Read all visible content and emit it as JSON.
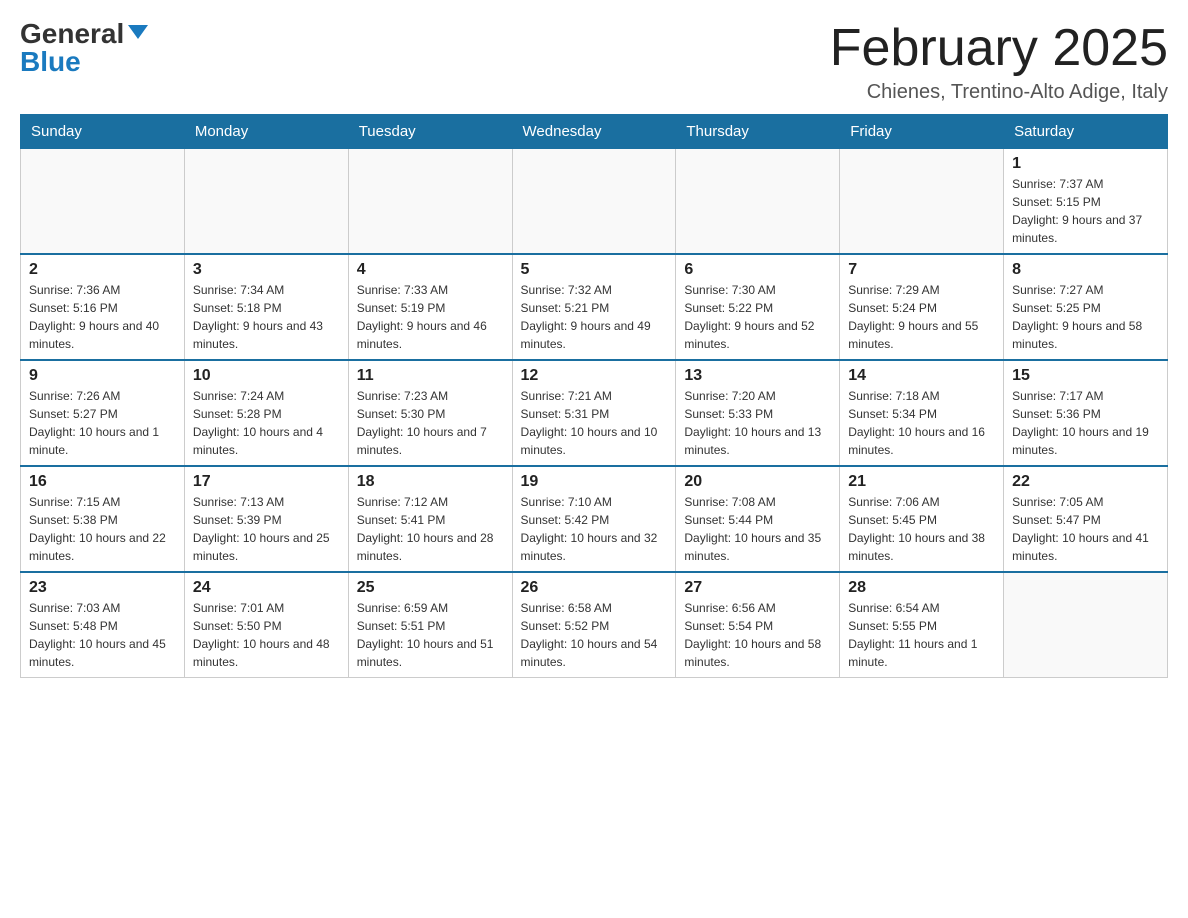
{
  "logo": {
    "general": "General",
    "blue": "Blue"
  },
  "title": "February 2025",
  "location": "Chienes, Trentino-Alto Adige, Italy",
  "weekdays": [
    "Sunday",
    "Monday",
    "Tuesday",
    "Wednesday",
    "Thursday",
    "Friday",
    "Saturday"
  ],
  "weeks": [
    [
      {
        "day": "",
        "info": ""
      },
      {
        "day": "",
        "info": ""
      },
      {
        "day": "",
        "info": ""
      },
      {
        "day": "",
        "info": ""
      },
      {
        "day": "",
        "info": ""
      },
      {
        "day": "",
        "info": ""
      },
      {
        "day": "1",
        "info": "Sunrise: 7:37 AM\nSunset: 5:15 PM\nDaylight: 9 hours and 37 minutes."
      }
    ],
    [
      {
        "day": "2",
        "info": "Sunrise: 7:36 AM\nSunset: 5:16 PM\nDaylight: 9 hours and 40 minutes."
      },
      {
        "day": "3",
        "info": "Sunrise: 7:34 AM\nSunset: 5:18 PM\nDaylight: 9 hours and 43 minutes."
      },
      {
        "day": "4",
        "info": "Sunrise: 7:33 AM\nSunset: 5:19 PM\nDaylight: 9 hours and 46 minutes."
      },
      {
        "day": "5",
        "info": "Sunrise: 7:32 AM\nSunset: 5:21 PM\nDaylight: 9 hours and 49 minutes."
      },
      {
        "day": "6",
        "info": "Sunrise: 7:30 AM\nSunset: 5:22 PM\nDaylight: 9 hours and 52 minutes."
      },
      {
        "day": "7",
        "info": "Sunrise: 7:29 AM\nSunset: 5:24 PM\nDaylight: 9 hours and 55 minutes."
      },
      {
        "day": "8",
        "info": "Sunrise: 7:27 AM\nSunset: 5:25 PM\nDaylight: 9 hours and 58 minutes."
      }
    ],
    [
      {
        "day": "9",
        "info": "Sunrise: 7:26 AM\nSunset: 5:27 PM\nDaylight: 10 hours and 1 minute."
      },
      {
        "day": "10",
        "info": "Sunrise: 7:24 AM\nSunset: 5:28 PM\nDaylight: 10 hours and 4 minutes."
      },
      {
        "day": "11",
        "info": "Sunrise: 7:23 AM\nSunset: 5:30 PM\nDaylight: 10 hours and 7 minutes."
      },
      {
        "day": "12",
        "info": "Sunrise: 7:21 AM\nSunset: 5:31 PM\nDaylight: 10 hours and 10 minutes."
      },
      {
        "day": "13",
        "info": "Sunrise: 7:20 AM\nSunset: 5:33 PM\nDaylight: 10 hours and 13 minutes."
      },
      {
        "day": "14",
        "info": "Sunrise: 7:18 AM\nSunset: 5:34 PM\nDaylight: 10 hours and 16 minutes."
      },
      {
        "day": "15",
        "info": "Sunrise: 7:17 AM\nSunset: 5:36 PM\nDaylight: 10 hours and 19 minutes."
      }
    ],
    [
      {
        "day": "16",
        "info": "Sunrise: 7:15 AM\nSunset: 5:38 PM\nDaylight: 10 hours and 22 minutes."
      },
      {
        "day": "17",
        "info": "Sunrise: 7:13 AM\nSunset: 5:39 PM\nDaylight: 10 hours and 25 minutes."
      },
      {
        "day": "18",
        "info": "Sunrise: 7:12 AM\nSunset: 5:41 PM\nDaylight: 10 hours and 28 minutes."
      },
      {
        "day": "19",
        "info": "Sunrise: 7:10 AM\nSunset: 5:42 PM\nDaylight: 10 hours and 32 minutes."
      },
      {
        "day": "20",
        "info": "Sunrise: 7:08 AM\nSunset: 5:44 PM\nDaylight: 10 hours and 35 minutes."
      },
      {
        "day": "21",
        "info": "Sunrise: 7:06 AM\nSunset: 5:45 PM\nDaylight: 10 hours and 38 minutes."
      },
      {
        "day": "22",
        "info": "Sunrise: 7:05 AM\nSunset: 5:47 PM\nDaylight: 10 hours and 41 minutes."
      }
    ],
    [
      {
        "day": "23",
        "info": "Sunrise: 7:03 AM\nSunset: 5:48 PM\nDaylight: 10 hours and 45 minutes."
      },
      {
        "day": "24",
        "info": "Sunrise: 7:01 AM\nSunset: 5:50 PM\nDaylight: 10 hours and 48 minutes."
      },
      {
        "day": "25",
        "info": "Sunrise: 6:59 AM\nSunset: 5:51 PM\nDaylight: 10 hours and 51 minutes."
      },
      {
        "day": "26",
        "info": "Sunrise: 6:58 AM\nSunset: 5:52 PM\nDaylight: 10 hours and 54 minutes."
      },
      {
        "day": "27",
        "info": "Sunrise: 6:56 AM\nSunset: 5:54 PM\nDaylight: 10 hours and 58 minutes."
      },
      {
        "day": "28",
        "info": "Sunrise: 6:54 AM\nSunset: 5:55 PM\nDaylight: 11 hours and 1 minute."
      },
      {
        "day": "",
        "info": ""
      }
    ]
  ]
}
